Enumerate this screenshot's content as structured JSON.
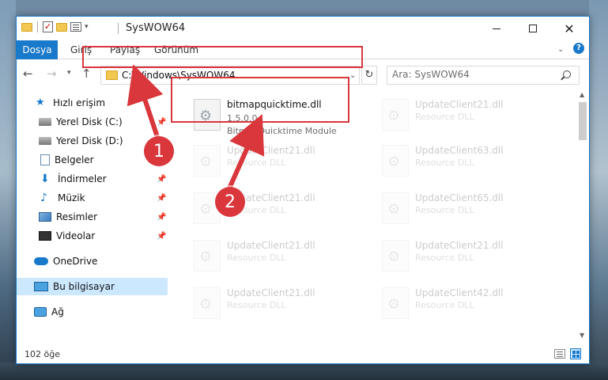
{
  "window": {
    "title": "SysWOW64"
  },
  "ribbon": {
    "tabs": [
      "Dosya",
      "Giriş",
      "Paylaş",
      "Görünüm"
    ]
  },
  "address": {
    "path": "C:\\Windows\\SysWOW64",
    "search_placeholder": "Ara: SysWOW64"
  },
  "sidebar": {
    "items": [
      {
        "label": "Hızlı erişim",
        "icon": "quick-access-star-icon"
      },
      {
        "label": "Yerel Disk (C:)",
        "icon": "drive-icon",
        "pinned": true
      },
      {
        "label": "Yerel Disk (D:)",
        "icon": "drive-icon"
      },
      {
        "label": "Belgeler",
        "icon": "documents-icon",
        "pinned": true
      },
      {
        "label": "İndirmeler",
        "icon": "downloads-icon",
        "pinned": true
      },
      {
        "label": "Müzik",
        "icon": "music-icon",
        "pinned": true
      },
      {
        "label": "Resimler",
        "icon": "pictures-icon",
        "pinned": true
      },
      {
        "label": "Videolar",
        "icon": "videos-icon",
        "pinned": true
      },
      {
        "label": "OneDrive",
        "icon": "onedrive-cloud-icon"
      },
      {
        "label": "Bu bilgisayar",
        "icon": "this-pc-icon",
        "selected": true
      },
      {
        "label": "Ağ",
        "icon": "network-icon"
      }
    ]
  },
  "files": {
    "highlighted": {
      "name": "bitmapquicktime.dll",
      "version": "1.5.0.0",
      "description": "BitmapQuicktime Module"
    },
    "others": [
      {
        "name": "UpdateClient21.dll",
        "type": "Resource DLL"
      },
      {
        "name": "UpdateClient21.dll",
        "type": "Resource DLL"
      },
      {
        "name": "UpdateClient63.dll",
        "type": "Resource DLL"
      },
      {
        "name": "UpdateClient21.dll",
        "type": "Resource DLL"
      },
      {
        "name": "UpdateClient65.dll",
        "type": "Resource DLL"
      },
      {
        "name": "UpdateClient21.dll",
        "type": "Resource DLL"
      },
      {
        "name": "UpdateClient21.dll",
        "type": "Resource DLL"
      },
      {
        "name": "UpdateClient21.dll",
        "type": "Resource DLL"
      },
      {
        "name": "UpdateClient42.dll",
        "type": "Resource DLL"
      }
    ]
  },
  "status": {
    "item_count": "102 öğe"
  },
  "callouts": [
    "1",
    "2"
  ],
  "colors": {
    "accent": "#1979ca",
    "highlight": "#d9373c",
    "selected_bg": "#cce8ff"
  }
}
